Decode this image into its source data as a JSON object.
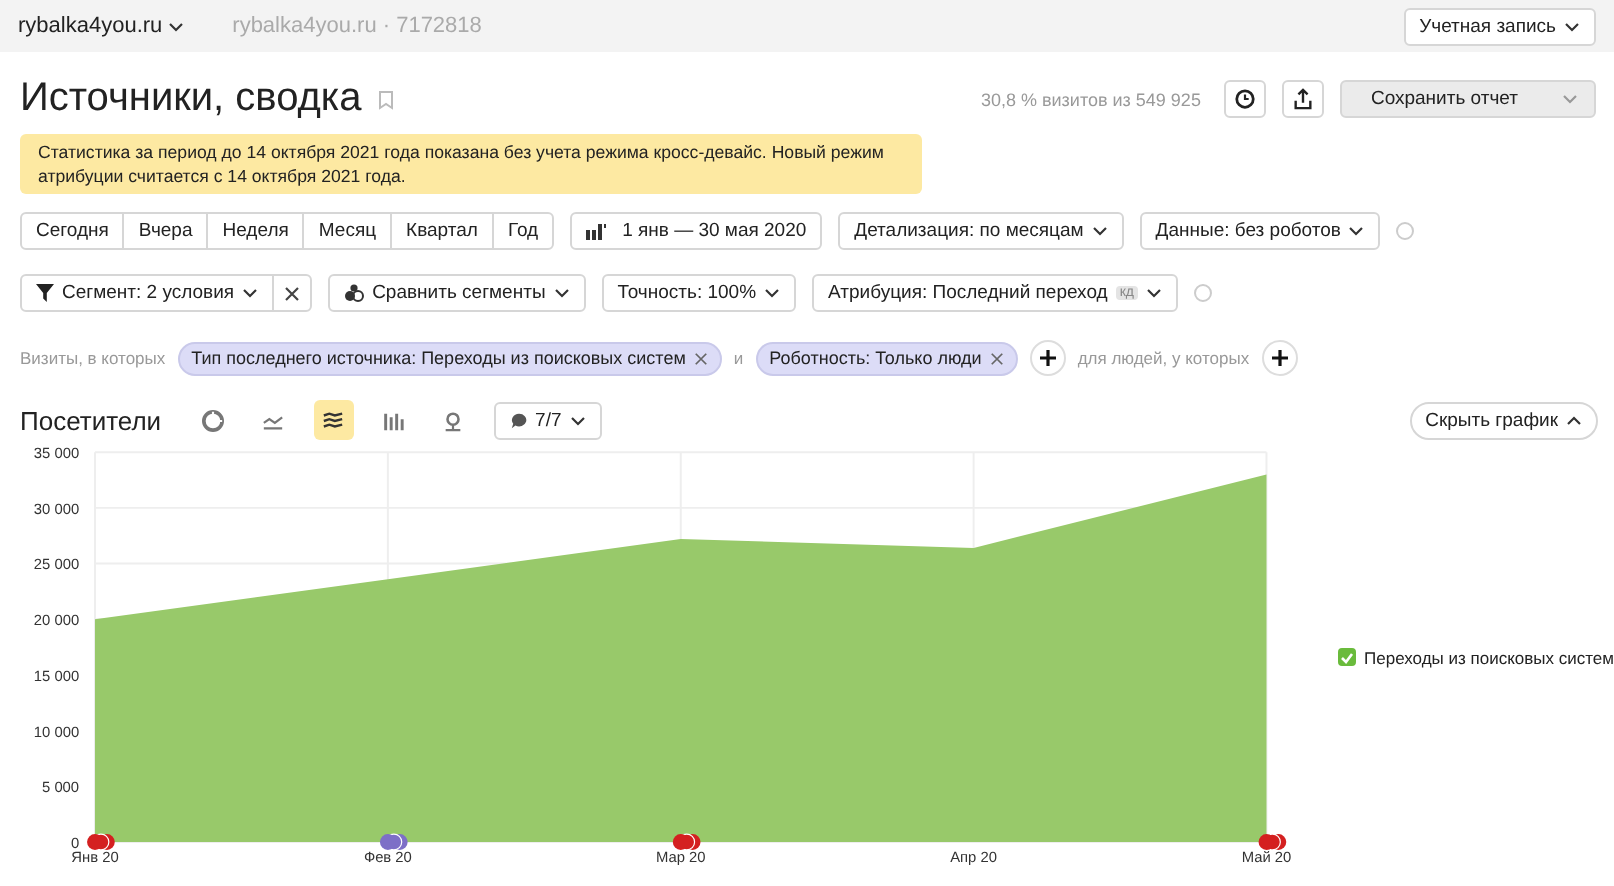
{
  "top_bar": {
    "site": "rybalka4you.ru",
    "counter": "rybalka4you.ru · 7172818",
    "account": "Учетная запись"
  },
  "header": {
    "title": "Источники, сводка",
    "sample": "30,8 % визитов из 549 925",
    "save": "Сохранить отчет"
  },
  "notice": "Статистика за период до 14 октября 2021 года показана без учета режима кросс-девайс. Новый режим атрибуции считается с 14 октября 2021 года.",
  "periods": [
    {
      "label": "Сегодня",
      "selected": false
    },
    {
      "label": "Вчера",
      "selected": false
    },
    {
      "label": "Неделя",
      "selected": false
    },
    {
      "label": "Месяц",
      "selected": false
    },
    {
      "label": "Квартал",
      "selected": false
    },
    {
      "label": "Год",
      "selected": false
    }
  ],
  "date_range": "1 янв — 30 мая 2020",
  "detail": "Детализация: по месяцам",
  "data_filter": "Данные: без роботов",
  "segment": "Сегмент: 2 условия",
  "compare": "Сравнить сегменты",
  "accuracy": "Точность: 100%",
  "attribution": {
    "label": "Атрибуция: Последний переход",
    "badge": "кд"
  },
  "conditions": {
    "prefix": "Визиты, в которых",
    "chips": [
      "Тип последнего источника: Переходы из поисковых систем",
      "Роботность: Только люди"
    ],
    "joiner": "и",
    "people": "для людей, у которых"
  },
  "chart_header": {
    "title": "Посетители",
    "types": [
      {
        "kind": "pie",
        "selected": false
      },
      {
        "kind": "line",
        "selected": false
      },
      {
        "kind": "area",
        "selected": true
      },
      {
        "kind": "bar",
        "selected": false
      },
      {
        "kind": "map",
        "selected": false
      }
    ],
    "notes": "7/7",
    "hide": "Скрыть график"
  },
  "chart": {
    "chart_data": {
      "type": "area",
      "grid": true,
      "categories": [
        "Янв 20",
        "Фев 20",
        "Мар 20",
        "Апр 20",
        "Май 20"
      ],
      "series": [
        {
          "name": "Переходы из поисковых систем",
          "color": "#98c96a",
          "values": [
            20000,
            23600,
            27200,
            26400,
            33000
          ]
        }
      ],
      "ylim": [
        0,
        35000
      ],
      "yticks": [
        0,
        {
          "value": 5000,
          "label": "5 000"
        },
        {
          "value": 10000,
          "label": "10 000"
        },
        {
          "value": 15000,
          "label": "15 000"
        },
        {
          "value": 20000,
          "label": "20 000"
        },
        {
          "value": 25000,
          "label": "25 000"
        },
        {
          "value": 30000,
          "label": "30 000"
        },
        {
          "value": 35000,
          "label": "35 000"
        }
      ]
    },
    "event_markers": [
      {
        "shown": true,
        "color": "#d42020"
      },
      {
        "shown": true,
        "color": "#7d6fc7"
      },
      {
        "shown": true,
        "color": "#d42020"
      },
      {
        "shown": false
      },
      {
        "shown": true,
        "color": "#d42020"
      }
    ],
    "legend_checked": true
  }
}
